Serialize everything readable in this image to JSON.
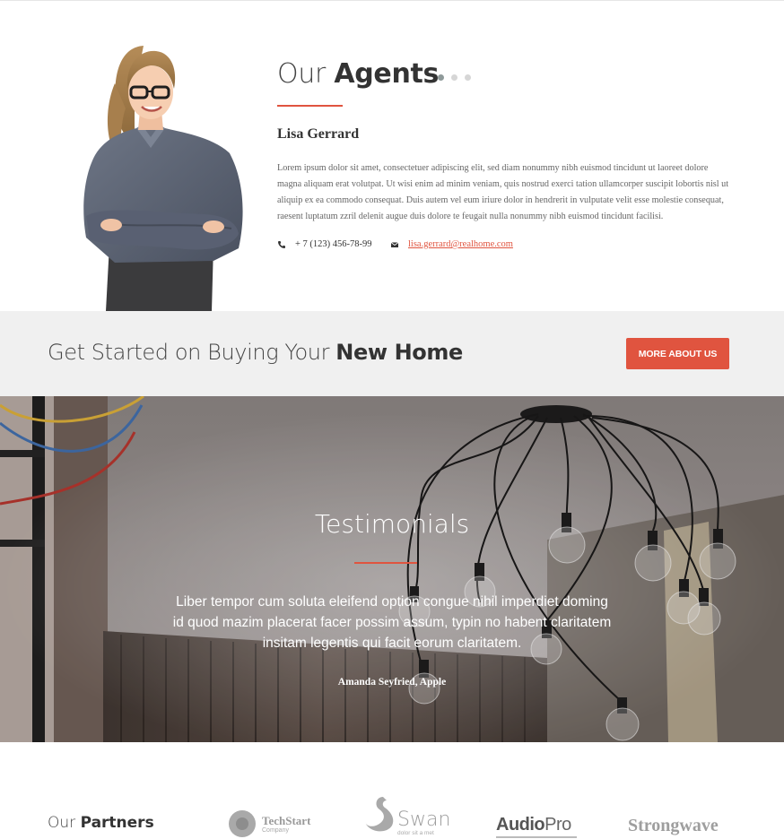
{
  "agents": {
    "title_light": "Our",
    "title_bold": "Agents",
    "agent_name": "Lisa Gerrard",
    "bio": "Lorem ipsum dolor sit amet, consectetuer adipiscing elit, sed diam nonummy nibh euismod tincidunt ut laoreet dolore magna aliquam erat volutpat. Ut wisi enim ad minim veniam, quis nostrud exerci tation ullamcorper suscipit lobortis nisl ut aliquip ex ea commodo consequat. Duis autem vel eum iriure dolor in hendrerit in vulputate velit esse molestie consequat, raesent luptatum zzril delenit augue duis dolore te feugait nulla nonummy nibh euismod tincidunt facilisi.",
    "phone": "+ 7 (123) 456-78-99",
    "email": "lisa.gerrard@realhome.com",
    "accent_color": "#e0543f"
  },
  "cta": {
    "text_light": "Get Started on Buying Your",
    "text_bold": "New Home",
    "button_label": "MORE ABOUT US",
    "button_color": "#e0543f"
  },
  "testimonials": {
    "title": "Testimonials",
    "quote": "Liber tempor cum soluta eleifend option congue nihil imperdiet doming id quod mazim placerat facer possim assum, typin no habent claritatem insitam legentis qui facit eorum claritatem.",
    "author": "Amanda Seyfried, Apple"
  },
  "partners": {
    "title_light": "Our",
    "title_bold": "Partners",
    "logos": {
      "techstart_name": "TechStart",
      "techstart_sub": "Company",
      "swan_name": "Swan",
      "swan_sub": "dolor sit a met",
      "audio_a": "Audio",
      "audio_b": "Pro",
      "strongwave": "Strongwave"
    }
  }
}
